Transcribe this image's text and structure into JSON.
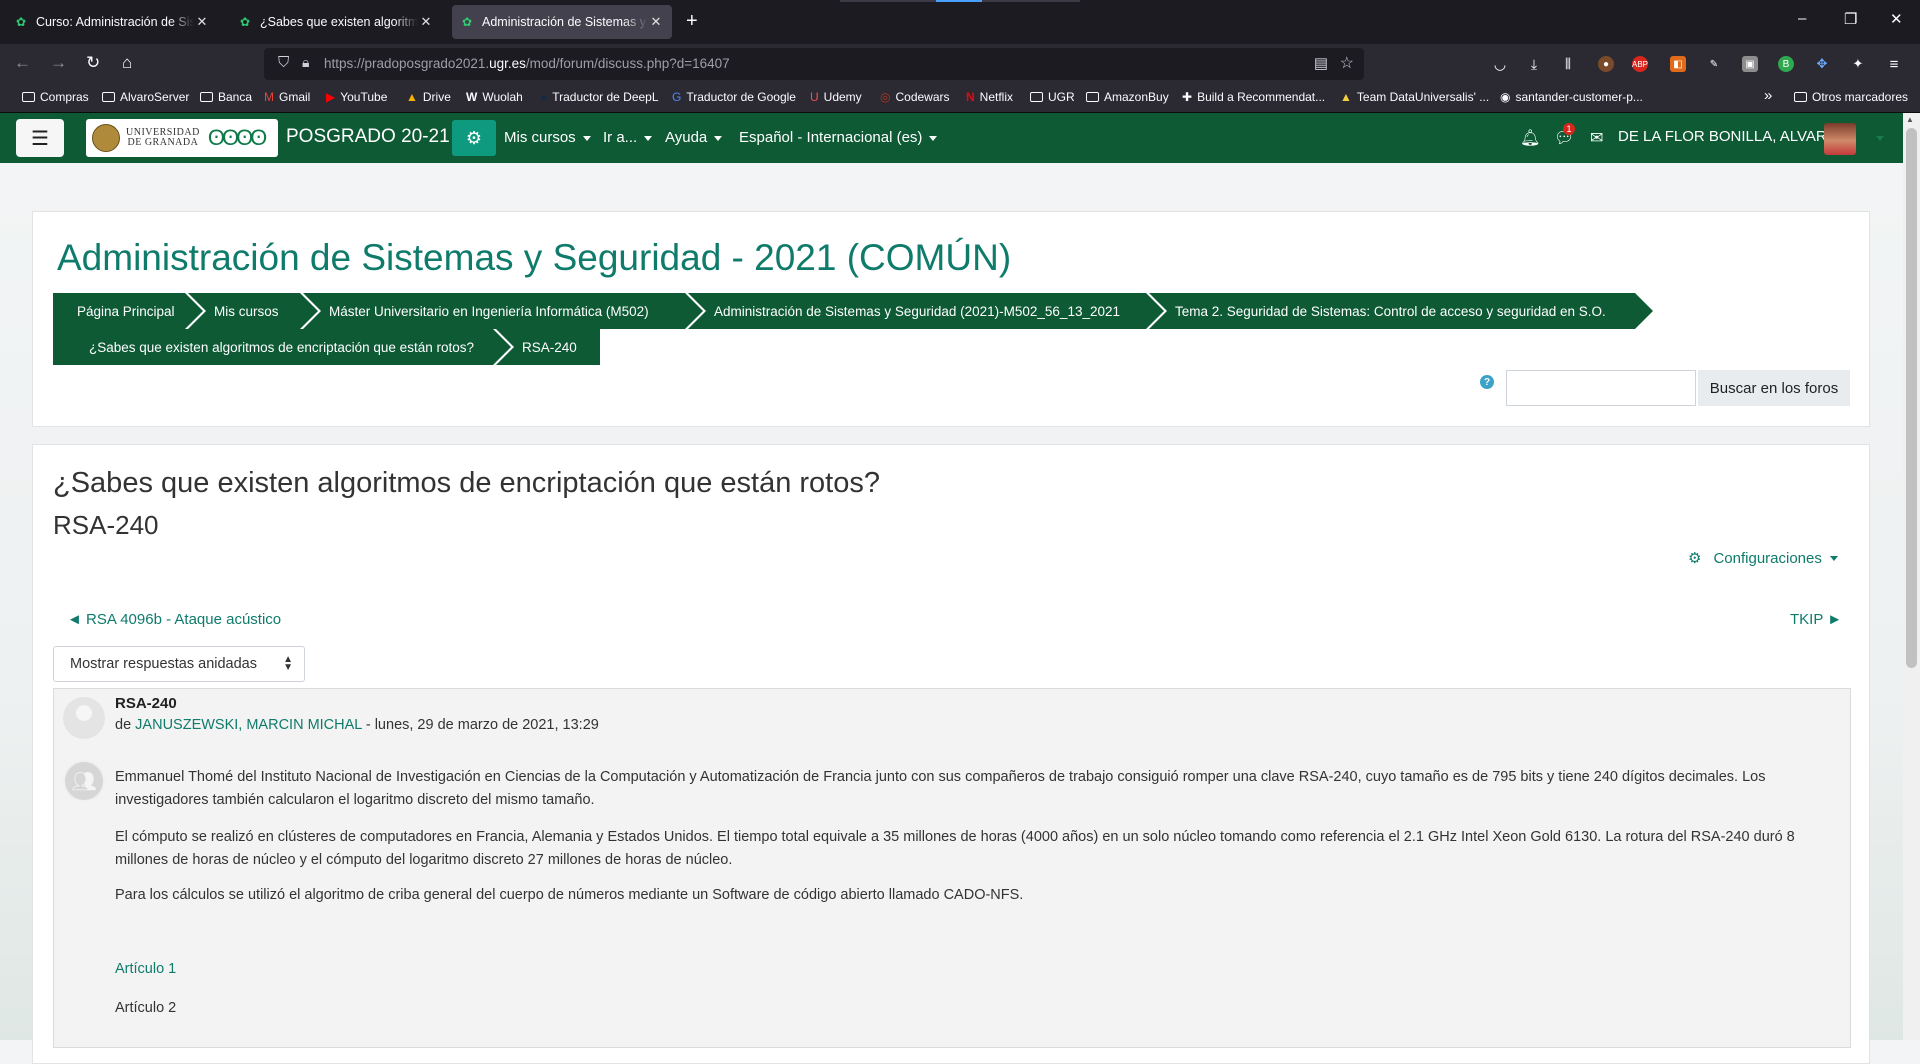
{
  "browser": {
    "tabs": [
      {
        "title": "Curso: Administración de Sistemas",
        "close": "✕"
      },
      {
        "title": "¿Sabes que existen algoritmos de encriptación",
        "close": "✕"
      },
      {
        "title": "Administración de Sistemas y Seguridad",
        "close": "✕"
      }
    ],
    "new_tab": "+",
    "window_buttons": [
      "–",
      "❐",
      "✕"
    ],
    "url_prefix": "https://pradoposgrado2021.",
    "url_domain": "ugr.es",
    "url_path": "/mod/forum/discuss.php?d=16407",
    "bookmarks": [
      {
        "label": "Compras",
        "icon": "folder"
      },
      {
        "label": "AlvaroServer",
        "icon": "folder"
      },
      {
        "label": "Banca",
        "icon": "folder"
      },
      {
        "label": "Gmail",
        "icon": "M"
      },
      {
        "label": "YouTube",
        "icon": "▶"
      },
      {
        "label": "Drive",
        "icon": "▲"
      },
      {
        "label": "Wuolah",
        "icon": "W"
      },
      {
        "label": "Traductor de DeepL",
        "icon": "●"
      },
      {
        "label": "Traductor de Google",
        "icon": "G"
      },
      {
        "label": "Udemy",
        "icon": "U"
      },
      {
        "label": "Codewars",
        "icon": "◎"
      },
      {
        "label": "Netflix",
        "icon": "N"
      },
      {
        "label": "UGR",
        "icon": "folder"
      },
      {
        "label": "AmazonBuy",
        "icon": "folder"
      },
      {
        "label": "Build a Recommendat...",
        "icon": "✚"
      },
      {
        "label": "Team DataUniversalis' ...",
        "icon": "▲"
      },
      {
        "label": "santander-customer-p...",
        "icon": "◉"
      }
    ],
    "bookmarks_overflow": "»",
    "other_bookmarks": "Otros marcadores"
  },
  "moodle_nav": {
    "logo_text_line1": "UNIVERSIDAD",
    "logo_text_line2": "DE GRANADA",
    "site_name": "POSGRADO 20-21",
    "menus": [
      "Mis cursos",
      "Ir a...",
      "Ayuda",
      "Español - Internacional (es)"
    ],
    "message_badge": "1",
    "user_name": "DE LA FLOR BONILLA, ALVARO"
  },
  "header": {
    "course_title": "Administración de Sistemas y Seguridad - 2021 (COMÚN)",
    "breadcrumbs_row1": [
      "Página Principal",
      "Mis cursos",
      "Máster Universitario en Ingeniería Informática (M502)",
      "Administración de Sistemas y Seguridad (2021)-M502_56_13_2021",
      "Tema 2. Seguridad de Sistemas: Control de acceso y seguridad en S.O."
    ],
    "breadcrumbs_row2": [
      "¿Sabes que existen algoritmos de encriptación que están rotos?",
      "RSA-240"
    ],
    "help_icon": "?",
    "search_placeholder": "",
    "search_button": "Buscar en los foros"
  },
  "discussion": {
    "forum_title": "¿Sabes que existen algoritmos de encriptación que están rotos?",
    "title": "RSA-240",
    "settings_label": "Configuraciones",
    "prev_link": "◄ RSA 4096b - Ataque acústico",
    "next_link": "TKIP ►",
    "display_mode": "Mostrar respuestas anidadas"
  },
  "post": {
    "subject": "RSA-240",
    "by_prefix": "de ",
    "author": "JANUSZEWSKI, MARCIN MICHAL",
    "date": " - lunes, 29 de marzo de 2021, 13:29",
    "paragraphs": [
      "Emmanuel Thomé del Instituto Nacional de Investigación en Ciencias de la Computación y Automatización de Francia junto con sus compañeros de trabajo consiguió romper una clave RSA-240, cuyo tamaño es de 795 bits y tiene 240 dígitos decimales. Los investigadores también calcularon el logaritmo discreto del mismo tamaño.",
      "El cómputo se realizó en clústeres de computadores en Francia, Alemania y Estados Unidos. El tiempo total equivale a 35 millones de horas (4000 años) en un solo núcleo tomando como referencia el 2.1 GHz Intel Xeon Gold 6130. La rotura del RSA-240 duró 8 millones de horas de núcleo y el cómputo del logaritmo discreto 27 millones de horas de núcleo.",
      "Para los cálculos se utilizó el algoritmo de criba general del cuerpo de números mediante un Software de código abierto llamado CADO-NFS."
    ],
    "link1": "Artículo 1",
    "link2": "Artículo 2"
  },
  "colors": {
    "nav_green": "#0d5a35",
    "link_teal": "#0f7b6b",
    "gear_button": "#0e9a7f"
  }
}
